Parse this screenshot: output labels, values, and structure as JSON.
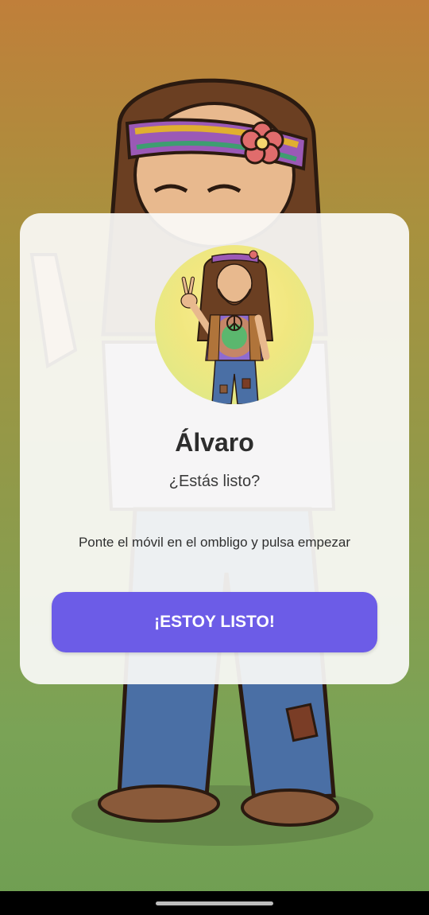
{
  "card": {
    "name": "Álvaro",
    "question": "¿Estás listo?",
    "instruction": "Ponte el móvil en el ombligo y pulsa empezar",
    "button_label": "¡ESTOY LISTO!"
  },
  "colors": {
    "accent": "#6c5ce7",
    "card_background": "#faf9f6",
    "background_top": "#c07f3a",
    "background_bottom": "#6f9e52"
  },
  "icons": {
    "avatar": "hippie-avatar-icon",
    "background": "hippie-illustration",
    "home_indicator": "home-indicator"
  }
}
